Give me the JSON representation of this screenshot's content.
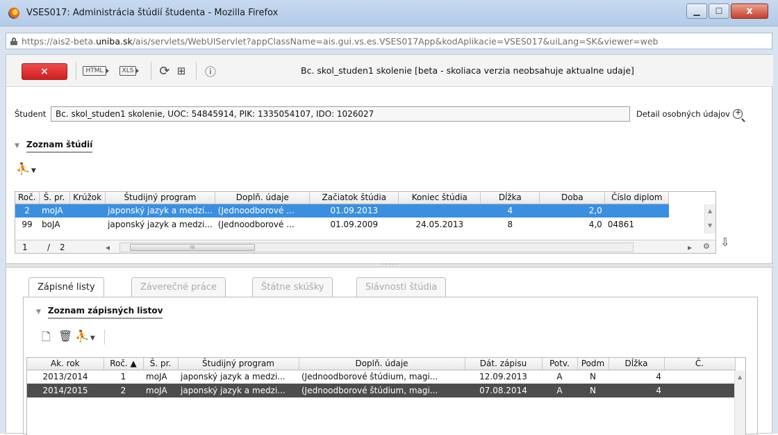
{
  "window": {
    "title": "VSES017: Administrácia štúdií študenta - Mozilla Firefox",
    "controls": {
      "minimize": "▁",
      "maximize": "☐",
      "close": "x"
    }
  },
  "address": {
    "url_prefix": "https://ais2-beta.",
    "url_domain": "uniba.sk",
    "url_rest": "/ais/servlets/WebUIServlet?appClassName=ais.gui.vs.es.VSES017App&kodAplikacie=VSES017&uiLang=SK&viewer=web"
  },
  "toolbar": {
    "close_label": "×",
    "html_label": "HTML",
    "xls_label": "XLS",
    "refresh_icon": "⟳",
    "print_icon": "⊞",
    "info_icon": "ⓘ",
    "header_text": "Bc. skol_studen1 skolenie [beta - skoliaca verzia neobsahuje aktualne udaje]"
  },
  "student": {
    "label": "Študent",
    "value": "Bc. skol_studen1 skolenie, UOC: 54845914, PIK: 1335054107, IDO: 1026027",
    "detail_link": "Detail osobných údajov"
  },
  "studies": {
    "title": "Zoznam štúdií",
    "columns": [
      "Roč.",
      "Š. pr.",
      "Krúžok",
      "Študijný program",
      "Doplň. údaje",
      "Začiatok štúdia",
      "Koniec štúdia",
      "Dĺžka",
      "Doba",
      "Číslo diplom"
    ],
    "rows": [
      [
        "2",
        "moJA",
        "",
        "japonský jazyk a medzi...",
        "(Jednoodborové ...",
        "01.09.2013",
        "",
        "4",
        "2,0",
        ""
      ],
      [
        "99",
        "boJA",
        "",
        "japonský jazyk a medzi...",
        "(Jednoodborové ...",
        "01.09.2009",
        "24.05.2013",
        "8",
        "4,0",
        "04861"
      ]
    ],
    "pager": {
      "current": "1",
      "sep": "/",
      "total": "2"
    },
    "scroll_mark": "III"
  },
  "tabs": [
    "Zápisné listy",
    "Záverečné práce",
    "Štátne skúšky",
    "Slávnosti štúdia"
  ],
  "enrollment": {
    "title": "Zoznam zápisných listov",
    "columns": [
      "Ak. rok",
      "Roč. ▲",
      "Š. pr.",
      "Študijný program",
      "Doplň. údaje",
      "Dát. zápisu",
      "Potv.",
      "Podm",
      "Dĺžka",
      "Č."
    ],
    "rows": [
      [
        "2013/2014",
        "1",
        "moJA",
        "japonský jazyk a medzi...",
        "(Jednoodborové štúdium, magi...",
        "12.09.2013",
        "A",
        "N",
        "4",
        ""
      ],
      [
        "2014/2015",
        "2",
        "moJA",
        "japonský jazyk a medzi...",
        "(Jednoodborové štúdium, magi...",
        "07.08.2014",
        "A",
        "N",
        "4",
        ""
      ]
    ]
  }
}
